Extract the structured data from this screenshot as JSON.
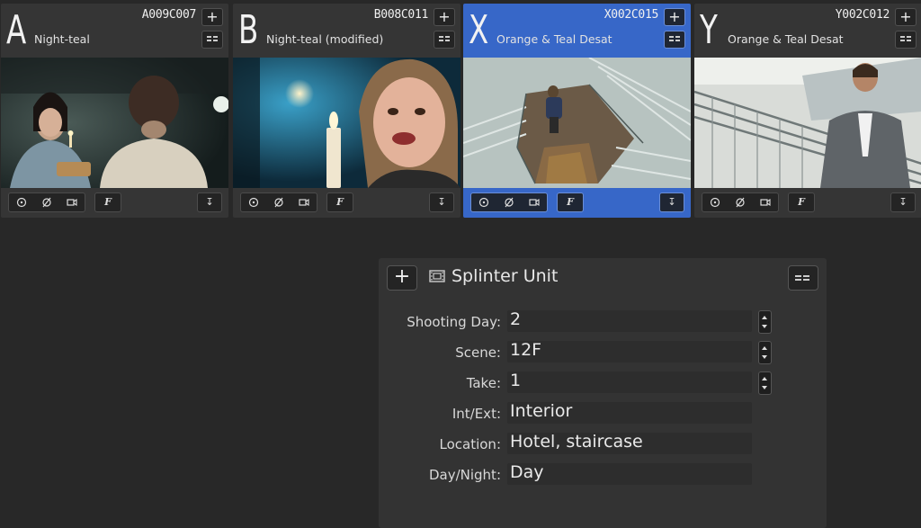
{
  "cameras": [
    {
      "letter": "A",
      "clip": "A009C007",
      "lut": "Night-teal",
      "active": false
    },
    {
      "letter": "B",
      "clip": "B008C011",
      "lut": "Night-teal (modified)",
      "active": false
    },
    {
      "letter": "X",
      "clip": "X002C015",
      "lut": "Orange & Teal Desat",
      "active": true
    },
    {
      "letter": "Y",
      "clip": "Y002C012",
      "lut": "Orange & Teal Desat",
      "active": false
    }
  ],
  "camera_controls": {
    "add_label": "+",
    "f_label": "F",
    "download_glyph": "↧"
  },
  "panel": {
    "add_label": "+",
    "title": "Splinter Unit",
    "title_icon": "film-strip-icon",
    "fields": {
      "shooting_day": {
        "label": "Shooting Day:",
        "value": "2"
      },
      "scene": {
        "label": "Scene:",
        "value": "12F"
      },
      "take": {
        "label": "Take:",
        "value": "1"
      },
      "int_ext": {
        "label": "Int/Ext:",
        "value": "Interior"
      },
      "location": {
        "label": "Location:",
        "value": "Hotel, staircase"
      },
      "day_night": {
        "label": "Day/Night:",
        "value": "Day"
      }
    }
  },
  "colors": {
    "background": "#282828",
    "card": "#353535",
    "active_card": "#3767c8",
    "panel": "#333333"
  }
}
